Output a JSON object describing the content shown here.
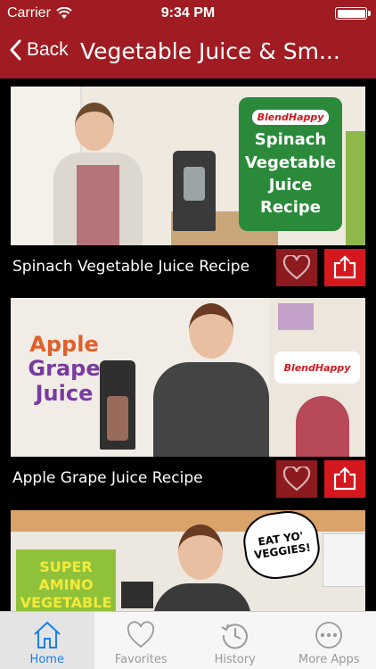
{
  "status_bar": {
    "carrier": "Carrier",
    "time": "9:34 PM"
  },
  "nav": {
    "back_label": "Back",
    "title": "Vegetable Juice & Sm..."
  },
  "videos": [
    {
      "title": "Spinach Vegetable Juice Recipe",
      "thumbnail_brand": "BlendHappy",
      "thumbnail_text": [
        "Spinach",
        "Vegetable",
        "Juice",
        "Recipe"
      ]
    },
    {
      "title": "Apple Grape Juice Recipe",
      "thumbnail_brand": "BlendHappy",
      "thumbnail_text": [
        "Apple",
        "Grape",
        "Juice"
      ]
    },
    {
      "title": "",
      "thumbnail_text": [
        "SUPER",
        "AMINO",
        "VEGETABLE"
      ],
      "thumbnail_bubble": [
        "EAT YO'",
        "VEGGIES!"
      ]
    }
  ],
  "tabs": [
    {
      "label": "Home",
      "icon": "home-icon",
      "active": true
    },
    {
      "label": "Favorites",
      "icon": "heart-icon",
      "active": false
    },
    {
      "label": "History",
      "icon": "history-icon",
      "active": false
    },
    {
      "label": "More Apps",
      "icon": "more-icon",
      "active": false
    }
  ],
  "colors": {
    "brand_red": "#a01c22",
    "share_red": "#d4181d",
    "active_tab": "#1a7fe8",
    "inactive_tab": "#9a9a9a"
  }
}
